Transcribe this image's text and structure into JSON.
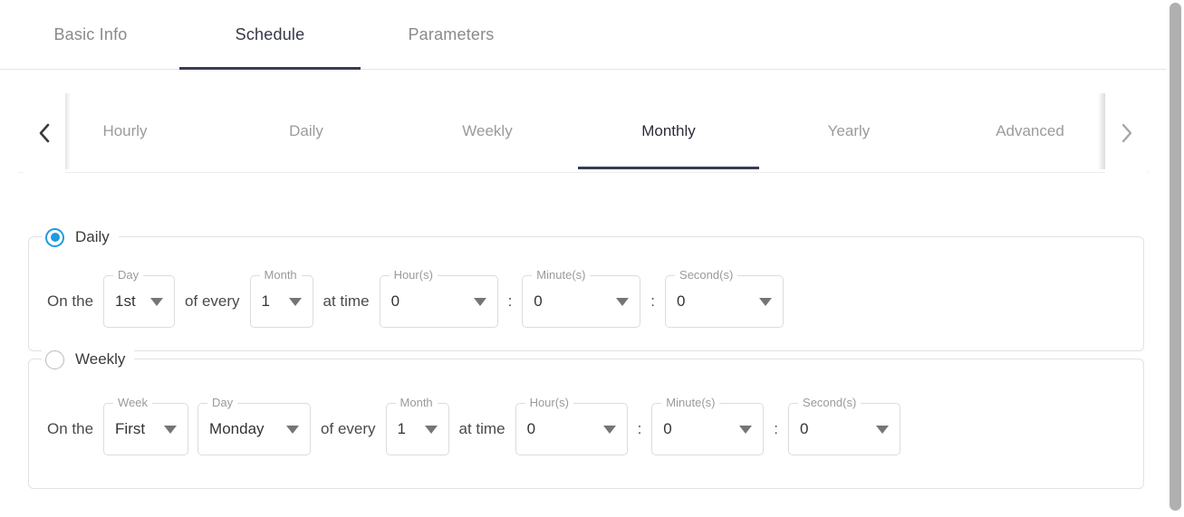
{
  "main_tabs": [
    {
      "label": "Basic Info",
      "active": false
    },
    {
      "label": "Schedule",
      "active": true
    },
    {
      "label": "Parameters",
      "active": false
    }
  ],
  "sub_tabs": {
    "prev_arrow_icon": "chevron-left-icon",
    "next_arrow_icon": "chevron-right-icon",
    "items": [
      {
        "label": "Hourly",
        "active": false
      },
      {
        "label": "Daily",
        "active": false
      },
      {
        "label": "Weekly",
        "active": false
      },
      {
        "label": "Monthly",
        "active": true
      },
      {
        "label": "Yearly",
        "active": false
      },
      {
        "label": "Advanced",
        "active": false
      }
    ]
  },
  "schedule_options": {
    "daily": {
      "radio_label": "Daily",
      "radio_selected": true,
      "prefix_text": "On the",
      "middle_text": "of every",
      "time_text": "at time",
      "colon": ":",
      "fields": [
        {
          "legend": "Day",
          "value": "1st"
        },
        {
          "legend": "Month",
          "value": "1"
        },
        {
          "legend": "Hour(s)",
          "value": "0"
        },
        {
          "legend": "Minute(s)",
          "value": "0"
        },
        {
          "legend": "Second(s)",
          "value": "0"
        }
      ]
    },
    "weekly": {
      "radio_label": "Weekly",
      "radio_selected": false,
      "prefix_text": "On the",
      "middle_text": "of every",
      "time_text": "at time",
      "colon": ":",
      "fields": [
        {
          "legend": "Week",
          "value": "First"
        },
        {
          "legend": "Day",
          "value": "Monday"
        },
        {
          "legend": "Month",
          "value": "1"
        },
        {
          "legend": "Hour(s)",
          "value": "0"
        },
        {
          "legend": "Minute(s)",
          "value": "0"
        },
        {
          "legend": "Second(s)",
          "value": "0"
        }
      ]
    }
  },
  "colors": {
    "active_underline": "#373c51",
    "radio_accent": "#1e9ae0",
    "inactive_text": "#9b9b9f",
    "active_text": "#2b2d3a",
    "field_border": "#dcdcdc"
  }
}
